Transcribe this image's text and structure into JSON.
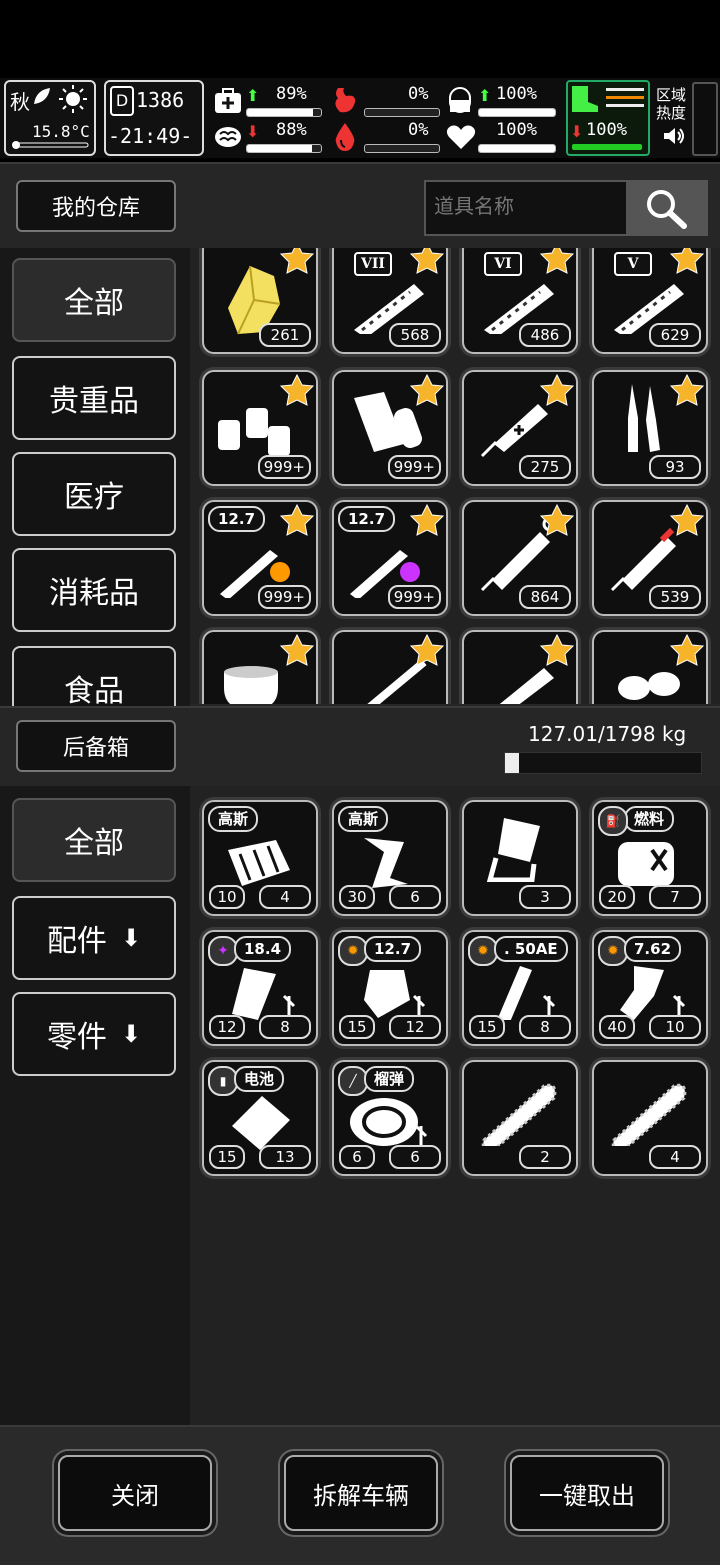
{
  "status": {
    "season": "秋",
    "temperature": "15.8°C",
    "day": "1386",
    "time": "-21:49-",
    "stats": [
      {
        "name": "health",
        "value": "89%",
        "trend": "up",
        "fill": 0.89
      },
      {
        "name": "hunger",
        "value": "0%",
        "trend": "none",
        "fill": 0.0
      },
      {
        "name": "medicine",
        "value": "100%",
        "trend": "up",
        "fill": 1.0
      },
      {
        "name": "mood",
        "value": "88%",
        "trend": "down",
        "fill": 0.88
      },
      {
        "name": "thirst",
        "value": "0%",
        "trend": "none",
        "fill": 0.0
      },
      {
        "name": "heart",
        "value": "100%",
        "trend": "none",
        "fill": 1.0
      }
    ],
    "stamina": {
      "value": "100%",
      "trend": "down",
      "fill": 1.0
    },
    "zone_label": "区域\n热度"
  },
  "warehouse": {
    "title": "我的仓库",
    "search_placeholder": "道具名称",
    "categories": [
      "全部",
      "贵重品",
      "医疗",
      "消耗品",
      "食品"
    ],
    "items": [
      {
        "icon": "crystal-icon",
        "count": "261",
        "star": true
      },
      {
        "icon": "syringe-vii-icon",
        "count": "568",
        "star": true,
        "roman": "VII"
      },
      {
        "icon": "syringe-vi-icon",
        "count": "486",
        "star": true,
        "roman": "VI"
      },
      {
        "icon": "syringe-v-icon",
        "count": "629",
        "star": true,
        "roman": "V"
      },
      {
        "icon": "pill-bottles-icon",
        "count": "999+",
        "star": true
      },
      {
        "icon": "bandage-roll-icon",
        "count": "999+",
        "star": true
      },
      {
        "icon": "adrenaline-injector-icon",
        "count": "275",
        "star": true
      },
      {
        "icon": "ampoules-icon",
        "count": "93",
        "star": true
      },
      {
        "icon": "bullet-explosive-icon",
        "count": "999+",
        "star": true,
        "tag": "12.7"
      },
      {
        "icon": "bullet-magic-icon",
        "count": "999+",
        "star": true,
        "tag": "12.7"
      },
      {
        "icon": "syringe-icon",
        "count": "864",
        "star": true
      },
      {
        "icon": "blood-syringe-icon",
        "count": "539",
        "star": true
      },
      {
        "icon": "coffee-cup-icon",
        "count": "",
        "star": true
      },
      {
        "icon": "stick-icon",
        "count": "",
        "star": true
      },
      {
        "icon": "baguette-icon",
        "count": "",
        "star": true
      },
      {
        "icon": "potatoes-icon",
        "count": "",
        "star": true
      }
    ]
  },
  "trunk": {
    "title": "后备箱",
    "weight": "127.01/1798 kg",
    "weight_fill": 0.0706,
    "categories": [
      "全部",
      "配件",
      "零件"
    ],
    "items": [
      {
        "icon": "gauss-magazine-icon",
        "tag": "高斯",
        "left": "10",
        "count": "4"
      },
      {
        "icon": "gauss-drum-icon",
        "tag": "高斯",
        "left": "30",
        "count": "6"
      },
      {
        "icon": "grip-mount-icon",
        "count": "3"
      },
      {
        "icon": "fuel-tank-icon",
        "tag": "燃料",
        "left": "20",
        "count": "7"
      },
      {
        "icon": "magazine-18-4-icon",
        "tag": "18.4",
        "left": "12",
        "count": "8"
      },
      {
        "icon": "magazine-12-7-icon",
        "tag": "12.7",
        "left": "15",
        "count": "12"
      },
      {
        "icon": "magazine-50ae-icon",
        "tag": ". 50AE",
        "left": "15",
        "count": "8"
      },
      {
        "icon": "magazine-7-62-icon",
        "tag": "7.62",
        "left": "40",
        "count": "10"
      },
      {
        "icon": "battery-pack-icon",
        "tag": "电池",
        "left": "15",
        "count": "13"
      },
      {
        "icon": "grenade-drum-icon",
        "tag": "榴弹",
        "left": "6",
        "count": "6"
      },
      {
        "icon": "chainsaw-blade-icon",
        "count": "2"
      },
      {
        "icon": "chainsaw-blade-2-icon",
        "count": "4"
      }
    ]
  },
  "buttons": {
    "close": "关闭",
    "dismantle": "拆解车辆",
    "take_all": "一键取出"
  }
}
